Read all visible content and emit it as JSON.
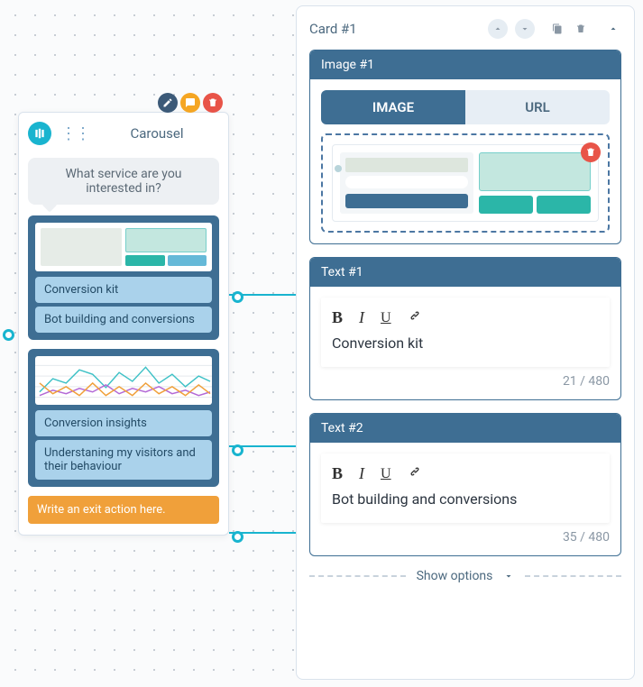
{
  "node": {
    "title": "Carousel",
    "prompt": "What service are you interested in?",
    "cards": [
      {
        "buttons": [
          "Conversion kit",
          "Bot building and conversions"
        ]
      },
      {
        "buttons": [
          "Conversion insights",
          "Understaning my visitors and their behaviour"
        ]
      }
    ],
    "exit_placeholder": "Write an exit action here."
  },
  "panel": {
    "title": "Card #1",
    "image_section": {
      "title": "Image #1",
      "tab_image": "IMAGE",
      "tab_url": "URL"
    },
    "text1": {
      "title": "Text #1",
      "value": "Conversion kit",
      "count": "21 / 480"
    },
    "text2": {
      "title": "Text #2",
      "value": "Bot building and conversions",
      "count": "35 / 480"
    },
    "show_options": "Show options"
  }
}
